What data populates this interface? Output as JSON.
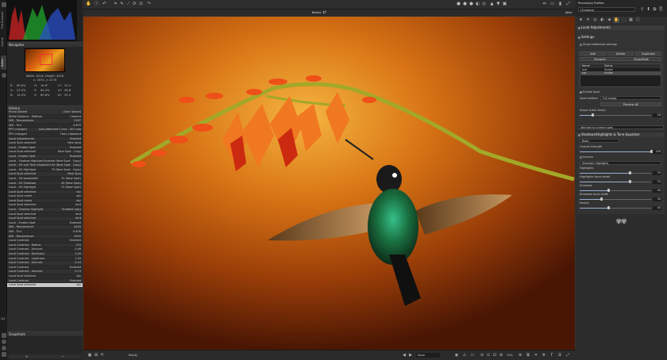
{
  "left_strip": {
    "file_browser_tab": "File Browser",
    "queue_tab": "Queue",
    "editor_tab": "Editor",
    "counter": "1/1"
  },
  "navigator": {
    "header": "Navigator",
    "size": "Width: 6016, Height: 4016",
    "coords": "x: 1674, y: 2278",
    "stats": [
      {
        "k": "R:",
        "v": "89.8%"
      },
      {
        "k": "G:",
        "v": "23.0%"
      },
      {
        "k": "B:",
        "v": "14.0%"
      },
      {
        "k": "H:",
        "v": "16.8°"
      },
      {
        "k": "S:",
        "v": "84.4%"
      },
      {
        "k": "V:",
        "v": "89.8%"
      },
      {
        "k": "L*:",
        "v": "53.4"
      },
      {
        "k": "a*:",
        "v": "58.8"
      },
      {
        "k": "b*:",
        "v": "55.4"
      }
    ]
  },
  "history": {
    "header": "History",
    "rows": [
      {
        "name": "Photo loaded",
        "val": "(User Saved)"
      },
      {
        "name": "White Balance - Method",
        "val": "Camera"
      },
      {
        "name": "WB - Temperature",
        "val": "5167"
      },
      {
        "name": "WB - Tint",
        "val": "0.853"
      },
      {
        "name": "PP3 changed",
        "val": "Auto-Matched Curve - ISO Low"
      },
      {
        "name": "PP3 changed",
        "val": "From clipboard"
      },
      {
        "name": "Local Adjustments",
        "val": "Enabled"
      },
      {
        "name": "Local Spot selected",
        "val": "New Spot"
      },
      {
        "name": "Local - Enable Spot",
        "val": "Enabled"
      },
      {
        "name": "Local Spot selected",
        "val": "New Spot - Copy"
      },
      {
        "name": "Local - Enable Spot",
        "val": "Enabled"
      },
      {
        "name": "Local - Shadow Highlight",
        "val": "Enabled (New Spot - Copy)"
      },
      {
        "name": "Local - SH and Tone Equalizer",
        "val": "100 (New Spot - Copy)"
      },
      {
        "name": "Local - SH Highlight",
        "val": "75 (New Spot - Copy)"
      },
      {
        "name": "Local Spot selected",
        "val": "New Spot"
      },
      {
        "name": "Local - SH tonalwidth",
        "val": "70 (New Spot)"
      },
      {
        "name": "Local - SH Shadows",
        "val": "40 (New Spot)"
      },
      {
        "name": "Local - SH Highlight",
        "val": "70 (New Spot)"
      },
      {
        "name": "Local Spot selected",
        "val": "sky"
      },
      {
        "name": "Local Spot name",
        "val": "sky"
      },
      {
        "name": "Local Spot name",
        "val": "sky"
      },
      {
        "name": "Local Spot selected",
        "val": "bird"
      },
      {
        "name": "Local - Shadow Highlight",
        "val": "Enabled (sky)"
      },
      {
        "name": "Local Spot selected",
        "val": "bird"
      },
      {
        "name": "Local Spot selected",
        "val": "bird"
      },
      {
        "name": "Local - Enable Spot",
        "val": "Enabled"
      },
      {
        "name": "WB - Temperature",
        "val": "5400"
      },
      {
        "name": "WB - Tint",
        "val": "0.836"
      },
      {
        "name": "WB - Temperature",
        "val": "5305"
      },
      {
        "name": "Local Contrast",
        "val": "Enabled"
      },
      {
        "name": "Local Contrast - Radius",
        "val": "120"
      },
      {
        "name": "Local Contrast - Amount",
        "val": "0.46"
      },
      {
        "name": "Local Contrast - Darkness",
        "val": "1.00"
      },
      {
        "name": "Local Contrast - Lightness",
        "val": "1.00"
      },
      {
        "name": "Local Contrast - Amount",
        "val": "0.44"
      },
      {
        "name": "Local Contrast",
        "val": "Enabled"
      },
      {
        "name": "Local Contrast - Amount",
        "val": "0.13"
      },
      {
        "name": "Local Spot selected",
        "val": "sky"
      },
      {
        "name": "Local Contrast",
        "val": "Enabled"
      },
      {
        "name": "Local Spot selected",
        "val": "sky"
      }
    ]
  },
  "snapshots": {
    "header": "Snapshots",
    "add": "+",
    "remove": "−"
  },
  "center": {
    "before_label": "Before",
    "after_label": "After",
    "status": "Ready",
    "zoom_mode": "None",
    "zoom": "15%"
  },
  "right": {
    "processing_profiles": "Processing Profiles",
    "profile_value": "(Custom)",
    "local_adjustments": "Local Adjustments",
    "settings": "Settings",
    "show_additional": "Show additional settings",
    "add_btn": "Add",
    "delete_btn": "Delete",
    "duplicate_btn": "Duplicate",
    "rename_btn": "Rename",
    "show_hide_btn": "Show/Hide",
    "table_headers": [
      "Name",
      "Status"
    ],
    "spots": [
      {
        "name": "bird",
        "status": "Visible"
      },
      {
        "name": "sky",
        "status": "Visible"
      }
    ],
    "enable_spot": "Enable Spot",
    "spot_method_label": "Spot method",
    "spot_method_value": "Full image",
    "preview_de": "Preview ΔE",
    "scope_label": "Scope (color tools)",
    "scope_value": "18",
    "add_tool": "Add tool to current spot...",
    "sh_header": "Shadows/Highlights & Tone Equalizer",
    "sh_mode": "Basic",
    "overall_label": "Overall strength",
    "overall_value": "100",
    "inverse": "Inverse",
    "method_value": "Shadows Highlights",
    "highlights_label": "Highlights",
    "highlights_value": "70",
    "hl_tonal_label": "Highlights tonal width",
    "hl_tonal_value": "70",
    "shadows_label": "Shadows",
    "shadows_value": "40",
    "sh_tonal_label": "Shadows tonal width",
    "sh_tonal_value": "30",
    "radius_label": "Radius",
    "radius_value": "40",
    "sliders": {
      "scope": 0.18,
      "overall": 1.0,
      "highlights": 0.7,
      "hl_tonal": 0.7,
      "shadows": 0.4,
      "sh_tonal": 0.3,
      "radius": 0.4
    }
  }
}
